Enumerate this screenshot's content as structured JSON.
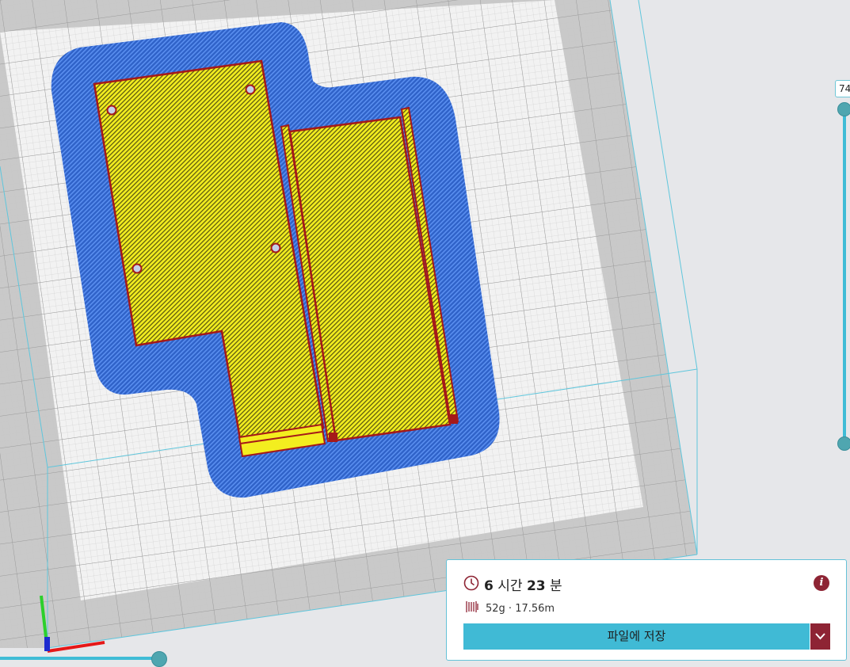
{
  "layer_slider": {
    "current_layer": "74"
  },
  "output": {
    "time_hours": "6",
    "time_hours_unit": "시간",
    "time_minutes": "23",
    "time_minutes_unit": "분",
    "material": "52g · 17.56m",
    "save_label": "파일에 저장"
  },
  "colors": {
    "background": "#e6e7ea",
    "build_plate": "#f2f2f2",
    "skirt_brim": "#2f62c8",
    "infill": "#f2ec1c",
    "outer_wall": "#a51919",
    "accent": "#40bad5",
    "secondary_button": "#8e2434"
  },
  "icons": {
    "time": "clock-icon",
    "material": "spool-icon",
    "info": "info-icon",
    "dropdown": "chevron-down-icon"
  }
}
